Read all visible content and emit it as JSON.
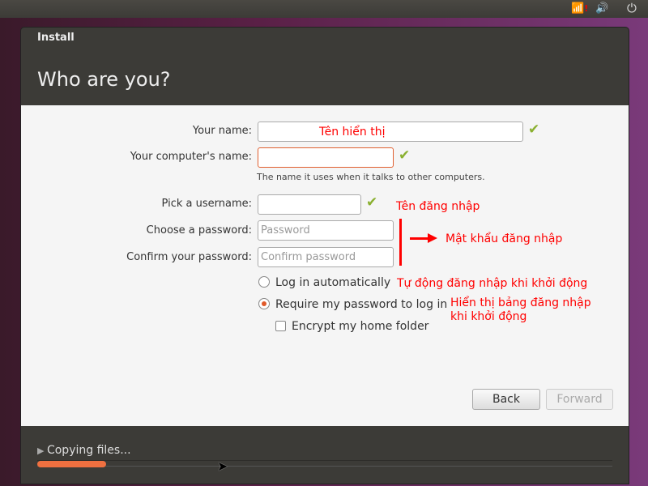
{
  "tray": {
    "icons": [
      "wifi-warning-icon",
      "volume-icon",
      "power-icon"
    ]
  },
  "window": {
    "title": "Install",
    "heading": "Who are you?"
  },
  "form": {
    "your_name_label": "Your name:",
    "your_name_value": "",
    "computer_name_label": "Your computer's name:",
    "computer_name_value": "",
    "computer_name_hint": "The name it uses when it talks to other computers.",
    "username_label": "Pick a username:",
    "username_value": "",
    "password_label": "Choose a password:",
    "password_placeholder": "Password",
    "confirm_label": "Confirm your password:",
    "confirm_placeholder": "Confirm password",
    "login_auto": "Log in automatically",
    "require_password": "Require my password to log in",
    "encrypt_home": "Encrypt my home folder",
    "selected_login": "require_password",
    "encrypt_checked": false
  },
  "annotations": {
    "name": "Tên hiển thị",
    "username": "Tên đăng nhập",
    "password": "Mật khẩu đăng nhập",
    "auto": "Tự động đăng nhập khi khởi động",
    "require_line1": "Hiển thị bảng đăng nhập",
    "require_line2": "khi khởi động"
  },
  "buttons": {
    "back": "Back",
    "forward": "Forward"
  },
  "status": {
    "text": "Copying files...",
    "progress_percent": 12,
    "accent": "#ef7040"
  }
}
